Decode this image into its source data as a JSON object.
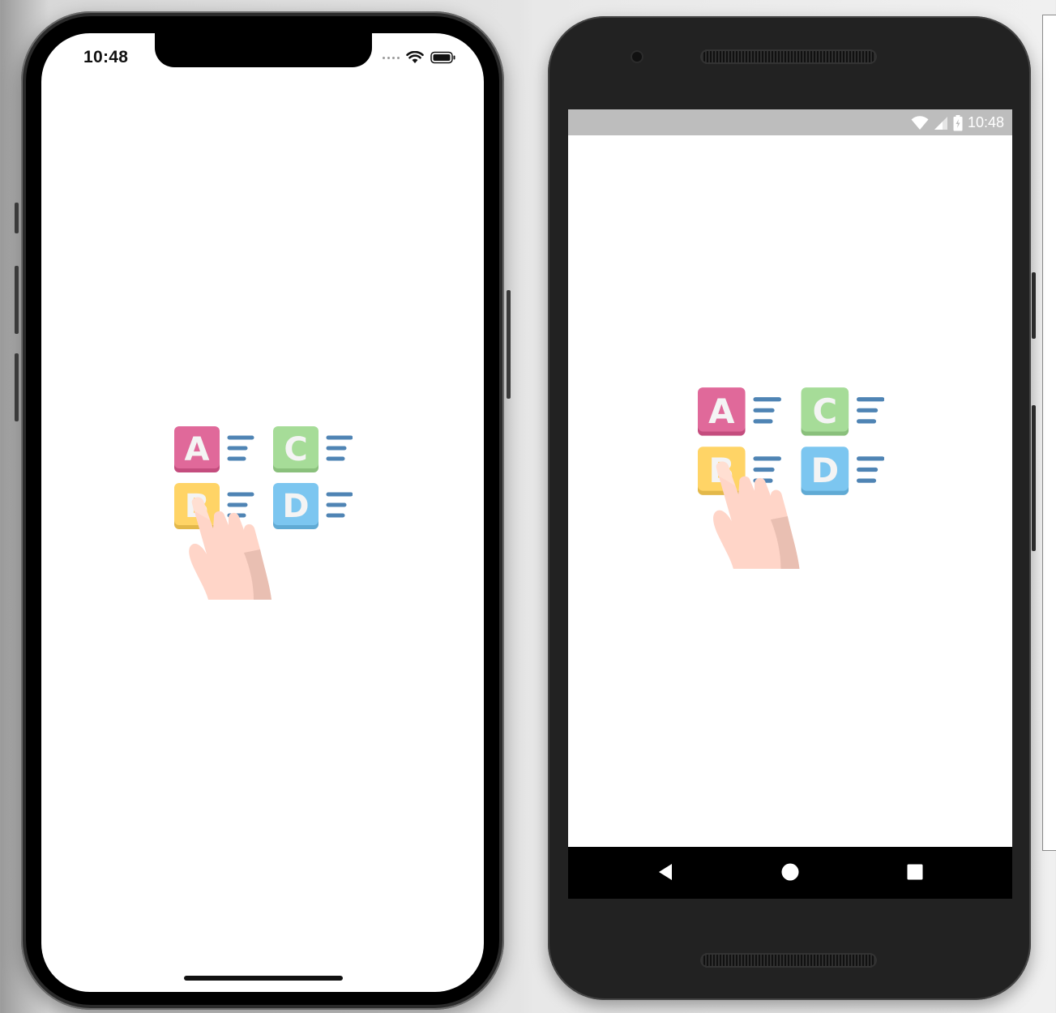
{
  "ios": {
    "status_time": "10:48",
    "icons": [
      "signal-dots-icon",
      "wifi-icon",
      "battery-icon"
    ]
  },
  "android": {
    "status_time": "10:48",
    "icons": [
      "wifi-icon",
      "cell-signal-icon",
      "battery-charging-icon"
    ],
    "nav": [
      "back-icon",
      "home-icon",
      "recents-icon"
    ]
  },
  "splash_icon": {
    "name": "quiz-choice-icon",
    "tiles": [
      {
        "letter": "A",
        "color": "#e0699a"
      },
      {
        "letter": "C",
        "color": "#a6dc98"
      },
      {
        "letter": "B",
        "color": "#ffd466"
      },
      {
        "letter": "D",
        "color": "#7cc6f0"
      }
    ],
    "lines_color": "#4f84b4",
    "hand_color": "#ffd5c8"
  }
}
